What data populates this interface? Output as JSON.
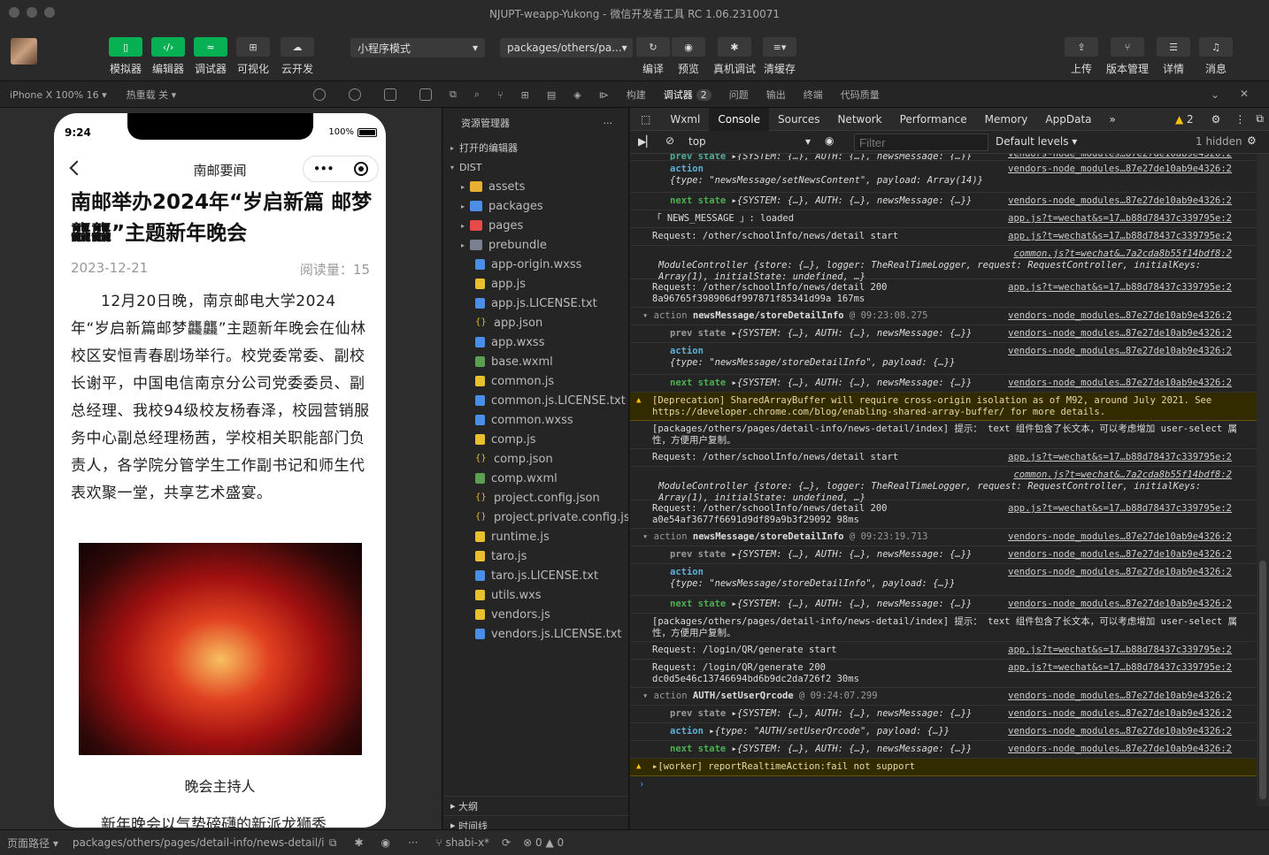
{
  "window": {
    "title": "NJUPT-weapp-Yukong - 微信开发者工具 RC 1.06.2310071"
  },
  "toolbar": {
    "simulator": "模拟器",
    "editor": "编辑器",
    "debugger": "调试器",
    "visual": "可视化",
    "cloud": "云开发",
    "mode_select": "小程序模式",
    "path_select": "packages/others/pa...",
    "compile": "编译",
    "preview": "预览",
    "real_debug": "真机调试",
    "clear_cache": "清缓存",
    "upload": "上传",
    "version": "版本管理",
    "details": "详情",
    "messages": "消息"
  },
  "sim_bar": {
    "device": "iPhone X 100% 16",
    "hotreload": "热重载 关"
  },
  "ide_tabs": {
    "build": "构建",
    "debugger": "调试器",
    "debugger_count": "2",
    "issues": "问题",
    "output": "输出",
    "terminal": "终端",
    "quality": "代码质量"
  },
  "phone": {
    "time": "9:24",
    "battery": "100%",
    "nav_title": "南邮要闻",
    "title": "南邮举办2024年“岁启新篇 邮梦龘龘”主题新年晚会",
    "date": "2023-12-21",
    "reads": "阅读量：15",
    "body": "12月20日晚，南京邮电大学2024年“岁启新篇邮梦龘龘”主题新年晚会在仙林校区安恒青春剧场举行。校党委常委、副校长谢平，中国电信南京分公司党委委员、副总经理、我校94级校友杨春泽，校园营销服务中心副总经理杨茜，学校相关职能部门负责人，各学院分管学生工作副书记和师生代表欢聚一堂，共享艺术盛宴。",
    "caption": "晚会主持人",
    "more": "新年晚会以气势磅礴的新派龙狮秀"
  },
  "explorer": {
    "header": "资源管理器",
    "open_editors": "打开的编辑器",
    "root": "DIST",
    "folders": [
      "assets",
      "packages",
      "pages",
      "prebundle"
    ],
    "files": [
      "app-origin.wxss",
      "app.js",
      "app.js.LICENSE.txt",
      "app.json",
      "app.wxss",
      "base.wxml",
      "common.js",
      "common.js.LICENSE.txt",
      "common.wxss",
      "comp.js",
      "comp.json",
      "comp.wxml",
      "project.config.json",
      "project.private.config.js...",
      "runtime.js",
      "taro.js",
      "taro.js.LICENSE.txt",
      "utils.wxs",
      "vendors.js",
      "vendors.js.LICENSE.txt"
    ],
    "outline": "大纲",
    "timeline": "时间线"
  },
  "devtools": {
    "tabs": [
      "Wxml",
      "Console",
      "Sources",
      "Network",
      "Performance",
      "Memory",
      "AppData"
    ],
    "warn_count": "2",
    "context": "top",
    "filter_placeholder": "Filter",
    "levels": "Default levels",
    "hidden": "1 hidden"
  },
  "console": {
    "src_vendor": "vendors-node_modules…87e27de10ab9e4326:2",
    "src_app": "app.js?t=wechat&s=17…b88d78437c339795e:2",
    "src_common": "common.js?t=wechat&…7a2cda8b55f14bdf8:2",
    "prev_state": "prev state",
    "next_state": "next state",
    "action_kw": "action",
    "state_obj": "▸{SYSTEM: {…}, AUTH: {…}, newsMessage: {…}}",
    "news_loaded": "「 NEWS_MESSAGE 」: loaded",
    "req_detail_start": "Request: /other/schoolInfo/news/detail start",
    "module_ctrl": "ModuleController {store: {…}, logger: TheRealTimeLogger, request: RequestController, initialKeys: Array(1), initialState: undefined, …}",
    "req_detail_200_a": "Request: /other/schoolInfo/news/detail 200 8a96765f398906df997871f85341d99a 167ms",
    "req_detail_200_b": "Request: /other/schoolInfo/news/detail 200 a0e54af3677f6691d9df89a9b3f29092 98ms",
    "grp_store1": "newsMessage/storeDetailInfo",
    "grp_store1_time": "@ 09:23:08.275",
    "grp_store2_time": "@ 09:23:19.713",
    "grp_auth": "AUTH/setUserQrcode",
    "grp_auth_time": "@ 09:24:07.299",
    "act_set_content": "{type: \"newsMessage/setNewsContent\", payload: Array(14)}",
    "act_store": "{type: \"newsMessage/storeDetailInfo\", payload: {…}}",
    "act_auth": "{type: \"AUTH/setUserQrcode\", payload: {…}}",
    "deprecation": "[Deprecation] SharedArrayBuffer will require cross-origin isolation as of M92, around July 2021. See https://developer.chrome.com/blog/enabling-shared-array-buffer/ for more details.",
    "hint": "[packages/others/pages/detail-info/news-detail/index]  提示： text 组件包含了长文本，可以考虑增加 user-select 属性，方便用户复制。",
    "qr_start": "Request: /login/QR/generate start",
    "qr_200": "Request: /login/QR/generate 200 dc0d5e46c13746694bd6b9dc2da726f2 30ms",
    "worker": "▸[worker] reportRealtimeAction:fail not support"
  },
  "statusbar": {
    "page_path_label": "页面路径",
    "page_path": "packages/others/pages/detail-info/news-detail/in...",
    "branch": "shabi-x*",
    "errors": "0",
    "warnings": "0"
  }
}
